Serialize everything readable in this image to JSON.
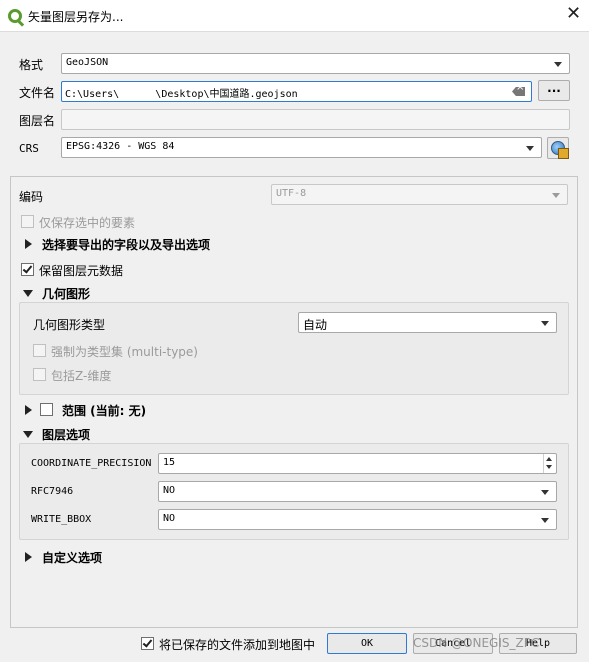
{
  "window": {
    "title": "矢量图层另存为...",
    "close_glyph": "✕"
  },
  "format": {
    "label": "格式",
    "value": "GeoJSON"
  },
  "filename": {
    "label": "文件名",
    "value": "C:\\Users\\      \\Desktop\\中国道路.geojson",
    "browse_label": "..."
  },
  "layername": {
    "label": "图层名",
    "value": ""
  },
  "crs": {
    "label": "CRS",
    "value": "EPSG:4326 - WGS 84"
  },
  "encoding": {
    "label": "编码",
    "value": "UTF-8"
  },
  "options": {
    "save_selected_label": "仅保存选中的要素",
    "select_fields_label": "选择要导出的字段以及导出选项",
    "persist_metadata_label": "保留图层元数据"
  },
  "geometry": {
    "section_label": "几何图形",
    "type_label": "几何图形类型",
    "type_value": "自动",
    "force_multi_label": "强制为类型集 (multi-type)",
    "include_z_label": "包括Z-维度"
  },
  "extent": {
    "section_label": "范围 (当前: 无)"
  },
  "layer_options": {
    "section_label": "图层选项",
    "rows": [
      {
        "key": "COORDINATE_PRECISION",
        "value": "15"
      },
      {
        "key": "RFC7946",
        "value": "NO"
      },
      {
        "key": "WRITE_BBOX",
        "value": "NO"
      }
    ]
  },
  "custom_options": {
    "section_label": "自定义选项"
  },
  "footer": {
    "add_to_map_label": "将已保存的文件添加到地图中",
    "ok_label": "OK",
    "cancel_label": "Cancel",
    "help_label": "Help",
    "watermark": "CSDN @ONEGIS_ZPC"
  },
  "colors": {
    "accent": "#2f7bd3",
    "qgis_green": "#5a9a2f"
  }
}
